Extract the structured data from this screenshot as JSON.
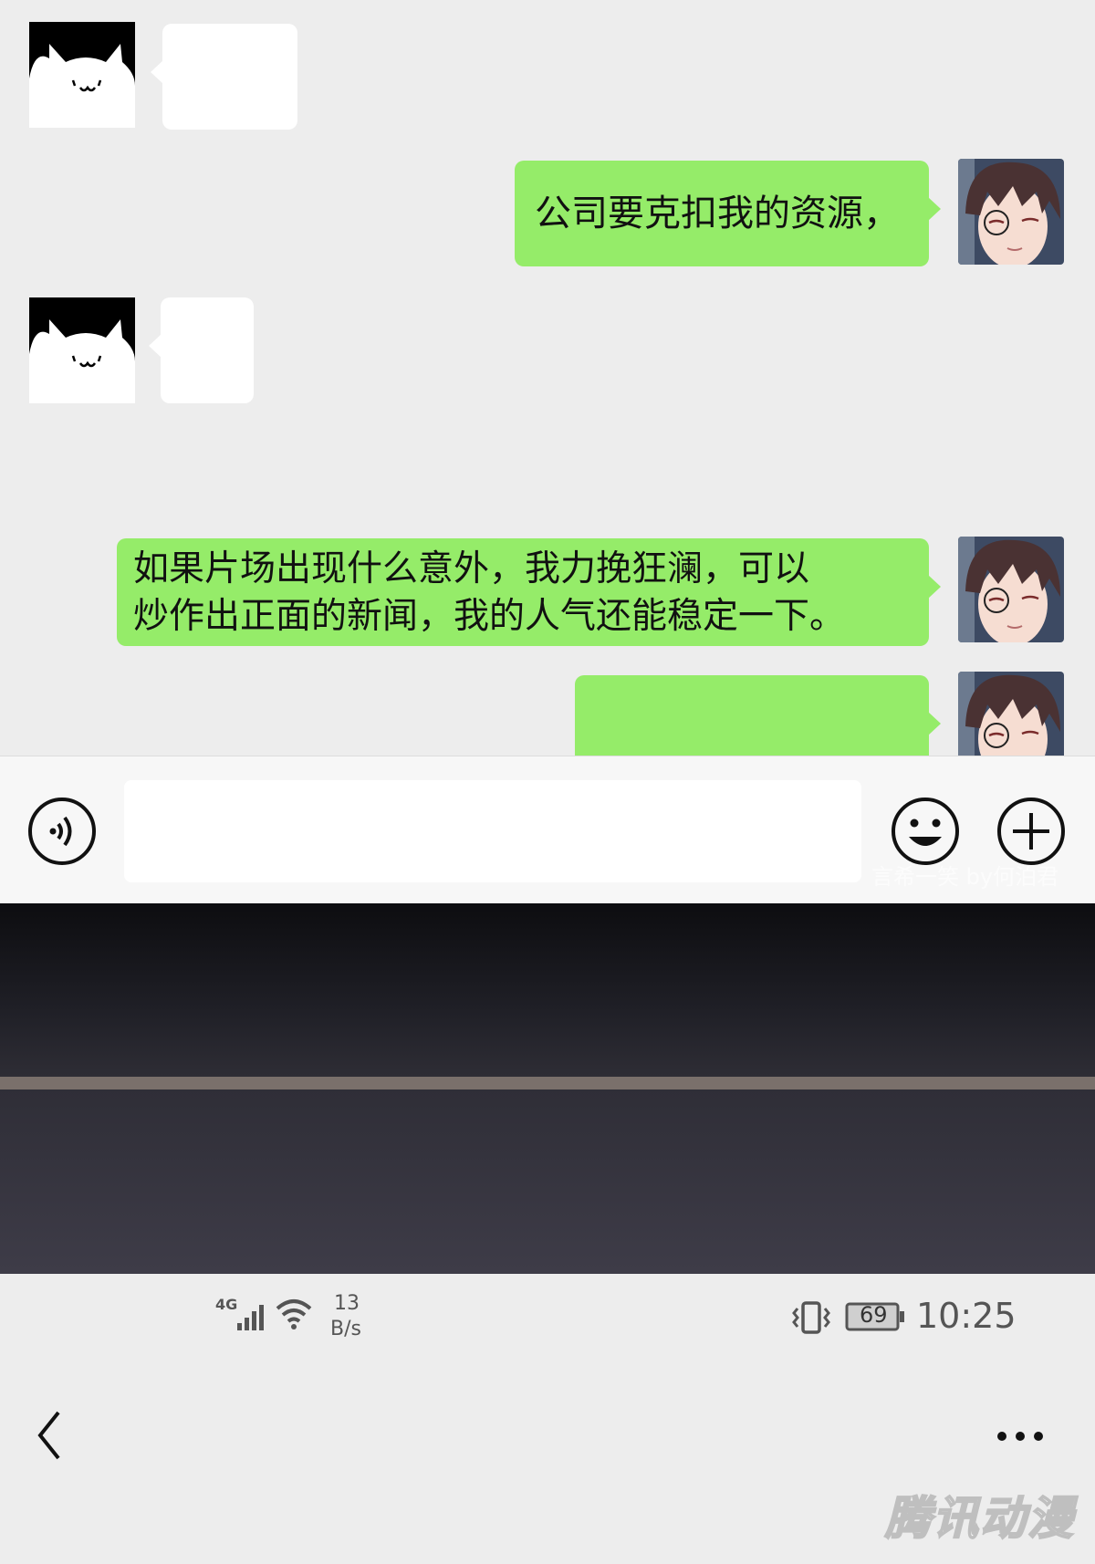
{
  "chat": {
    "messages": [
      {
        "side": "left",
        "avatar": "cat-avatar",
        "text": ""
      },
      {
        "side": "right",
        "avatar": "boy-avatar",
        "text": "公司要克扣我的资源，"
      },
      {
        "side": "left",
        "avatar": "cat-avatar",
        "text": ""
      },
      {
        "side": "right",
        "avatar": "boy-avatar",
        "lines": [
          "如果片场出现什么意外，我力挽狂澜，可以",
          "炒作出正面的新闻，我的人气还能稳定一下。"
        ]
      },
      {
        "side": "right",
        "avatar": "boy-avatar",
        "text": ""
      }
    ]
  },
  "input_bar": {
    "voice_icon": "voice-icon",
    "emoji_icon": "emoji-icon",
    "plus_icon": "plus-icon",
    "input_value": "",
    "overlay_text": "言希一笑 by何泊君"
  },
  "status_bar": {
    "network": "4G",
    "speed_value": "13",
    "speed_unit": "B/s",
    "battery": "69",
    "time": "10:25",
    "icons": [
      "signal-icon",
      "wifi-icon",
      "vibrate-icon",
      "battery-icon"
    ]
  },
  "nav_bar": {
    "back_icon": "chevron-left-icon",
    "more_icon": "more-dots-icon"
  },
  "watermark": "腾讯动漫",
  "colors": {
    "chat_bg": "#ededed",
    "bubble_sent": "#95ec69",
    "bubble_received": "#ffffff",
    "input_bar_bg": "#f7f7f7"
  }
}
